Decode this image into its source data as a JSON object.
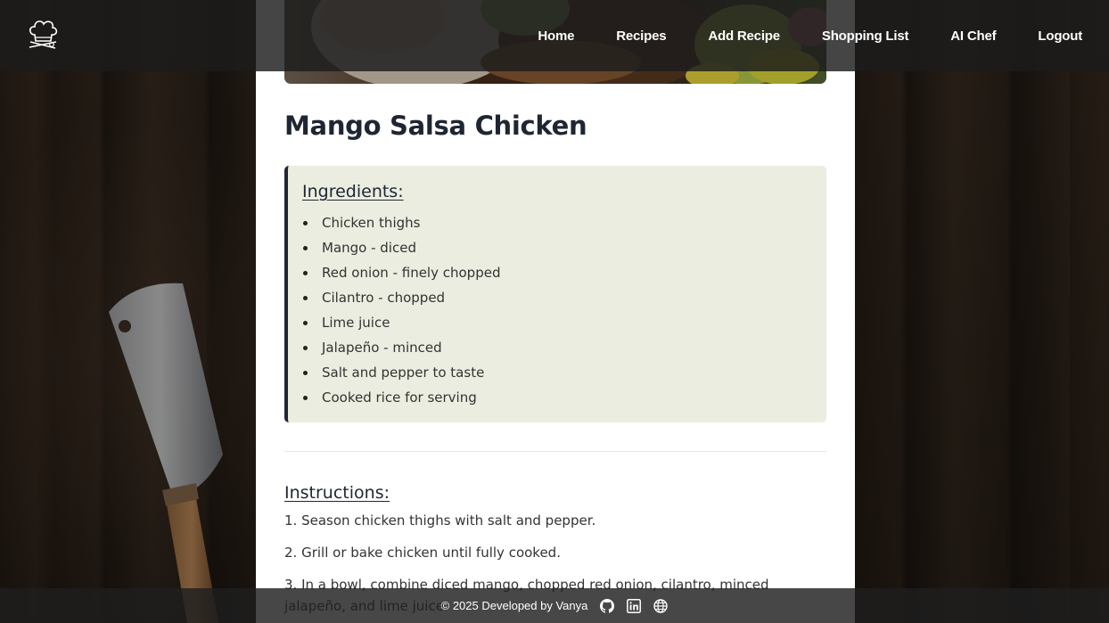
{
  "navbar": {
    "logo_icon": "chef-hat-icon",
    "links": [
      "Home",
      "Recipes",
      "Add Recipe",
      "Shopping List",
      "AI Chef",
      "Logout"
    ]
  },
  "recipe": {
    "title": "Mango Salsa Chicken",
    "ingredients_heading": "Ingredients:",
    "ingredients": [
      "Chicken thighs",
      "Mango - diced",
      "Red onion - finely chopped",
      "Cilantro - chopped",
      "Lime juice",
      "Jalapeño - minced",
      "Salt and pepper to taste",
      "Cooked rice for serving"
    ],
    "instructions_heading": "Instructions:",
    "instructions": [
      "1. Season chicken thighs with salt and pepper.",
      "2. Grill or bake chicken until fully cooked.",
      "3. In a bowl, combine diced mango, chopped red onion, cilantro, minced jalapeño, and lime juice."
    ]
  },
  "footer": {
    "text": "© 2025 Developed by Vanya",
    "icons": [
      "github-icon",
      "linkedin-icon",
      "globe-icon"
    ]
  },
  "colors": {
    "heading": "#1f2633",
    "ingredients_bg": "#ebede0",
    "navbar_bg": "#1c1c1c"
  }
}
